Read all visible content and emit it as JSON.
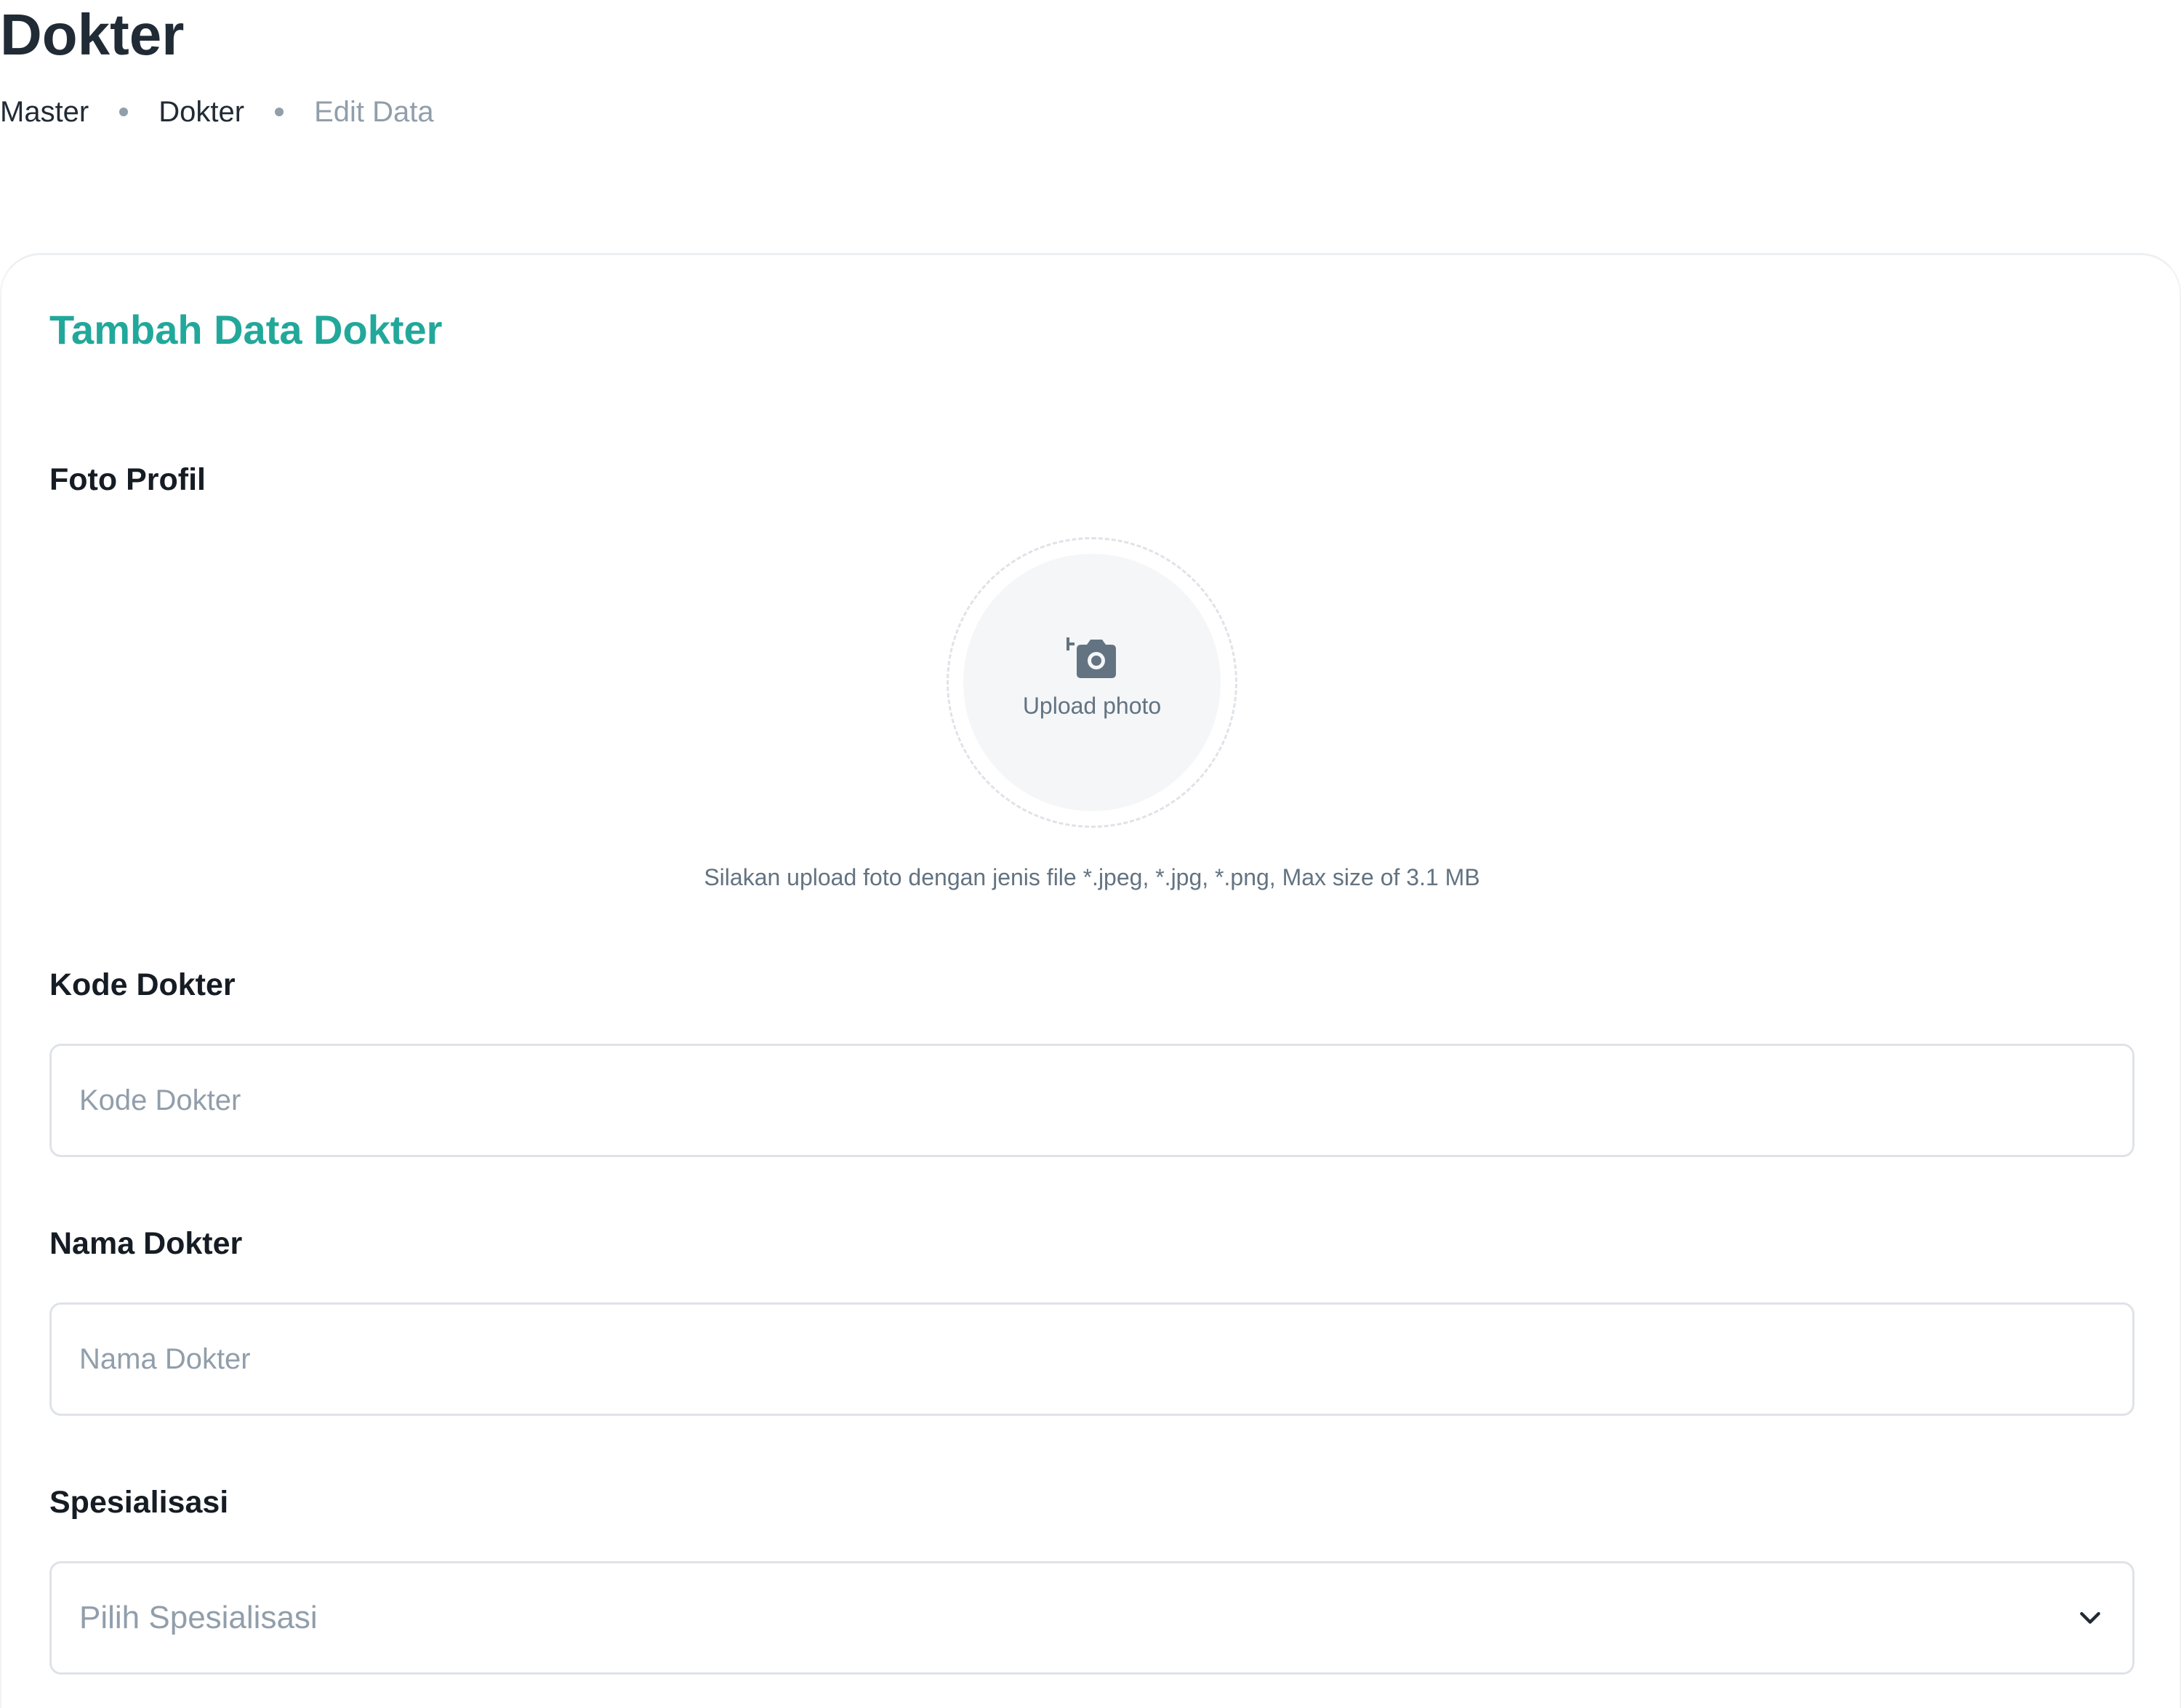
{
  "page": {
    "title": "Dokter",
    "breadcrumb": [
      {
        "label": "Master"
      },
      {
        "label": "Dokter"
      },
      {
        "label": "Edit Data"
      }
    ]
  },
  "form": {
    "title": "Tambah Data Dokter",
    "photo": {
      "label": "Foto Profil",
      "button_label": "Upload photo",
      "icon": "add-photo-camera-icon",
      "hint": "Silakan upload foto dengan jenis file *.jpeg, *.jpg, *.png, Max size of 3.1 MB"
    },
    "kode": {
      "label": "Kode Dokter",
      "value": "",
      "placeholder": "Kode Dokter"
    },
    "nama": {
      "label": "Nama Dokter",
      "value": "",
      "placeholder": "Nama Dokter"
    },
    "spesialisasi": {
      "label": "Spesialisasi",
      "selected": "Pilih Spesialisasi",
      "icon": "chevron-down-icon"
    }
  },
  "colors": {
    "accent": "#22a89a",
    "text_primary": "#212b36",
    "text_muted": "#919eab",
    "border": "#dfe3e8"
  }
}
